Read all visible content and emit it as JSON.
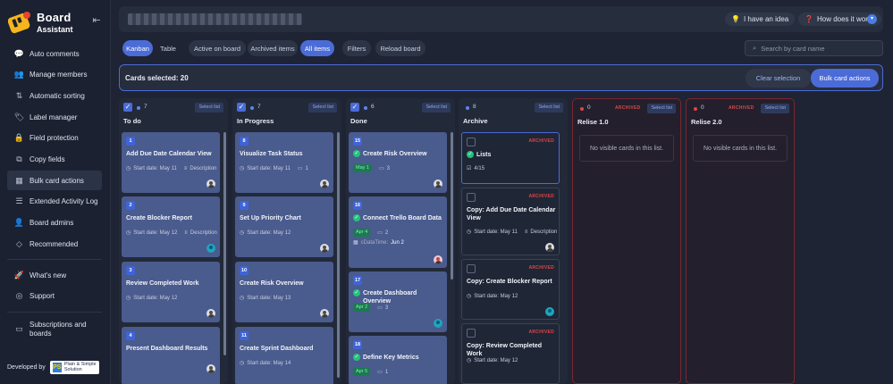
{
  "app": {
    "name": "Board",
    "subtitle": "Assistant"
  },
  "sidebar": {
    "items": [
      {
        "label": "Auto comments",
        "icon": "comment-icon"
      },
      {
        "label": "Manage members",
        "icon": "members-icon"
      },
      {
        "label": "Automatic sorting",
        "icon": "sort-icon"
      },
      {
        "label": "Label manager",
        "icon": "label-icon"
      },
      {
        "label": "Field protection",
        "icon": "lock-icon"
      },
      {
        "label": "Copy fields",
        "icon": "copy-icon"
      },
      {
        "label": "Bulk card actions",
        "icon": "bulk-icon"
      },
      {
        "label": "Extended Activity Log",
        "icon": "log-icon"
      },
      {
        "label": "Board admins",
        "icon": "admin-icon"
      },
      {
        "label": "Recommended",
        "icon": "diamond-icon"
      }
    ],
    "extra": [
      {
        "label": "What's new",
        "icon": "rocket-icon"
      },
      {
        "label": "Support",
        "icon": "support-icon"
      }
    ],
    "bottom": {
      "label": "Subscriptions and boards",
      "icon": "subscription-icon"
    },
    "footer": {
      "developed_by": "Developed by",
      "partner_line1": "Plain & Simple",
      "partner_line2": "Solution"
    }
  },
  "header": {
    "idea_label": "I have an idea",
    "how_label": "How does it work?"
  },
  "toolbar": {
    "kanban": "Kanban",
    "table": "Table",
    "active": "Active on board",
    "archived": "Archived items",
    "all": "All items",
    "filters": "Filters",
    "reload": "Reload board",
    "search_placeholder": "Search by card name"
  },
  "selection": {
    "text": "Cards selected: 20",
    "clear": "Clear selection",
    "bulk": "Bulk card actions"
  },
  "select_list_label": "Select list",
  "archived_label": "ARCHIVED",
  "empty_message": "No visible cards in this list.",
  "columns": [
    {
      "title": "To do",
      "count": "7"
    },
    {
      "title": "In Progress",
      "count": "7"
    },
    {
      "title": "Done",
      "count": "6"
    },
    {
      "title": "Archive",
      "count": "8"
    },
    {
      "title": "Relise 1.0",
      "count": "0"
    },
    {
      "title": "Relise 2.0",
      "count": "0"
    }
  ],
  "cards": {
    "todo": [
      {
        "num": "1",
        "title": "Add Due Date Calendar View",
        "date": "Start date: May 11",
        "desc": "Description"
      },
      {
        "num": "2",
        "title": "Create Blocker Report",
        "date": "Start date: May 12",
        "desc": "Description"
      },
      {
        "num": "3",
        "title": "Review Completed Work",
        "date": "Start date: May 12"
      },
      {
        "num": "4",
        "title": "Present Dashboard Results"
      }
    ],
    "progress": [
      {
        "num": "8",
        "title": "Visualize Task Status",
        "date": "Start date: May 11",
        "comments": "1"
      },
      {
        "num": "9",
        "title": "Set Up Priority Chart",
        "date": "Start date: May 12"
      },
      {
        "num": "10",
        "title": "Create Risk Overview",
        "date": "Start date: May 13"
      },
      {
        "num": "11",
        "title": "Create Sprint Dashboard",
        "date": "Start date: May 14"
      }
    ],
    "done": [
      {
        "num": "15",
        "title": "Create Risk Overview",
        "chip": "May 1",
        "comments": "3"
      },
      {
        "num": "16",
        "title": "Connect Trello Board Data",
        "chip": "Apr 4",
        "comments": "2",
        "field": "cDataTime:",
        "field_value": "Jun 2"
      },
      {
        "num": "17",
        "title": "Create Dashboard Overview",
        "chip": "Apr 2",
        "comments": "3"
      },
      {
        "num": "18",
        "title": "Define Key Metrics",
        "chip": "Apr 5",
        "comments": "1"
      }
    ],
    "archive": [
      {
        "title": "Lists",
        "checklist": "4/15"
      },
      {
        "title": "Copy: Add Due Date Calendar View",
        "date": "Start date: May 11",
        "desc": "Description"
      },
      {
        "title": "Copy: Create Blocker Report",
        "date": "Start date: May 12"
      },
      {
        "title": "Copy: Review Completed Work",
        "date": "Start date: May 12"
      }
    ]
  },
  "colors": {
    "accent": "#4b6bd6",
    "card": "#4a5b8e",
    "archived": "#e04646",
    "done_chip": "#1c7a4e"
  }
}
